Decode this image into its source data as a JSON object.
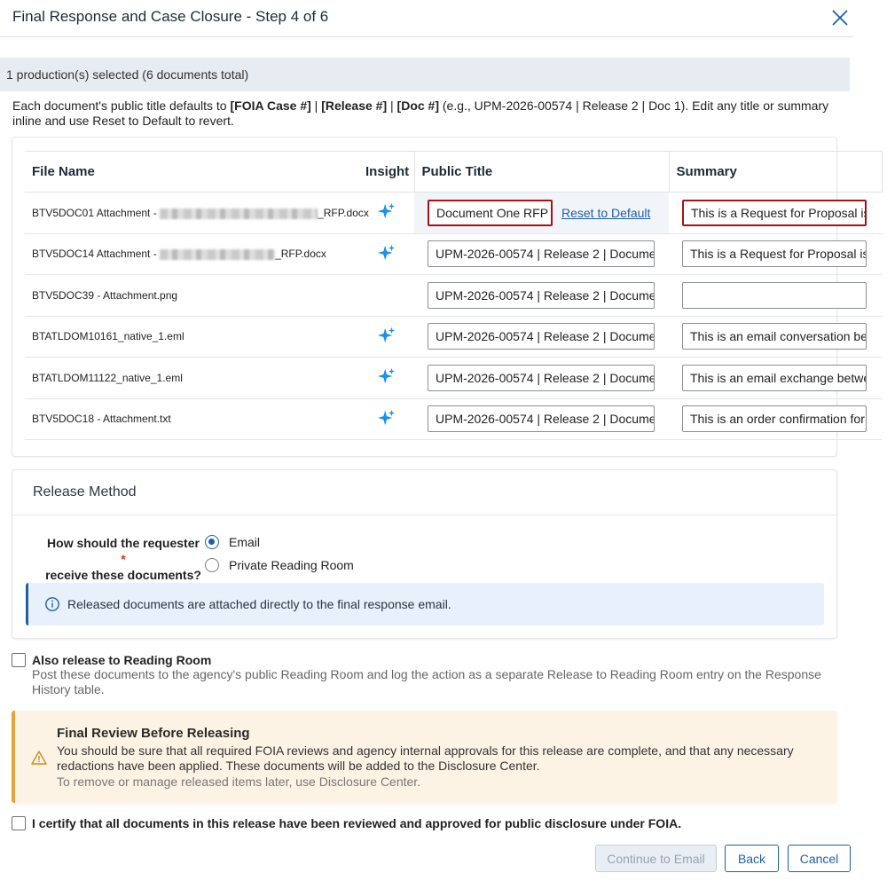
{
  "dialog": {
    "title": "Final Response and Case Closure - Step 4 of 6",
    "close_icon": "close-x-icon"
  },
  "selection_bar": {
    "text": "1 production(s) selected (6 documents total)"
  },
  "intro": {
    "prefix": "Each document's public title defaults to ",
    "token_case": "[FOIA Case #]",
    "sep1": " | ",
    "token_release": "[Release #]",
    "sep2": " | ",
    "token_doc": "[Doc #]",
    "suffix": " (e.g., UPM-2026-00574 | Release 2 | Doc 1). Edit any title or summary inline and use Reset to Default to revert."
  },
  "table": {
    "headers": {
      "file_name": "File Name",
      "insight": "Insight",
      "public_title": "Public Title",
      "summary": "Summary"
    },
    "rows": [
      {
        "file_prefix": "BTV5DOC01 Attachment - ",
        "file_suffix": "_RFP.docx",
        "redacted": true,
        "insight": true,
        "public_title": "Document One RFP",
        "reset_label": "Reset to Default",
        "summary": "This is a Request for Proposal is"
      },
      {
        "file_prefix": "BTV5DOC14 Attachment - ",
        "file_suffix": "_RFP.docx",
        "redacted": true,
        "insight": true,
        "public_title": "UPM-2026-00574 | Release 2 | Documen",
        "summary": "This is a Request for Proposal is"
      },
      {
        "file_prefix": "BTV5DOC39 - Attachment.png",
        "file_suffix": "",
        "redacted": false,
        "insight": false,
        "public_title": "UPM-2026-00574 | Release 2 | Documen",
        "summary": ""
      },
      {
        "file_prefix": "BTATLDOM10161_native_1.eml",
        "file_suffix": "",
        "redacted": false,
        "insight": true,
        "public_title": "UPM-2026-00574 | Release 2 | Documen",
        "summary": "This is an email conversation be"
      },
      {
        "file_prefix": "BTATLDOM11122_native_1.eml",
        "file_suffix": "",
        "redacted": false,
        "insight": true,
        "public_title": "UPM-2026-00574 | Release 2 | Documen",
        "summary": "This is an email exchange betwe"
      },
      {
        "file_prefix": "BTV5DOC18 - Attachment.txt",
        "file_suffix": "",
        "redacted": false,
        "insight": true,
        "public_title": "UPM-2026-00574 | Release 2 | Documen",
        "summary": "This is an order confirmation for"
      }
    ]
  },
  "release_method": {
    "title": "Release Method",
    "question_line1": "How should the requester",
    "question_line2": "receive these documents?",
    "required_mark": "*",
    "options": [
      {
        "label": "Email",
        "selected": true
      },
      {
        "label": "Private Reading Room",
        "selected": false
      }
    ],
    "info_text": "Released documents are attached directly to the final response email."
  },
  "reading_room": {
    "label": "Also release to Reading Room",
    "description": "Post these documents to the agency's public Reading Room and log the action as a separate Release to Reading Room entry on the Response History table.",
    "checked": false
  },
  "final_review": {
    "title": "Final Review Before Releasing",
    "body": "You should be sure that all required FOIA reviews and agency internal approvals for this release are complete, and that any necessary redactions have been applied. These documents will be added to the Disclosure Center.",
    "sub": "To remove or manage released items later, use Disclosure Center."
  },
  "certify": {
    "label": "I certify that all documents in this release have been reviewed and approved for public disclosure under FOIA.",
    "checked": false
  },
  "buttons": {
    "continue": "Continue to Email",
    "back": "Back",
    "cancel": "Cancel"
  },
  "colors": {
    "primary": "#1f5fa8",
    "highlight_border": "#a31218",
    "warning_accent": "#e6a23c",
    "info_bg": "#e8f1fb",
    "warning_bg": "#fdf3e4",
    "insight_icon": "#1e90e8"
  }
}
